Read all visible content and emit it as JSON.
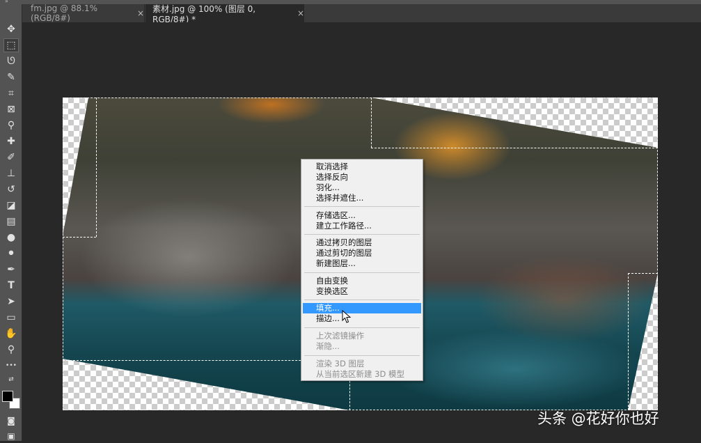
{
  "tabs": [
    {
      "label": "fm.jpg @ 88.1%(RGB/8#)",
      "close": "×",
      "active": false
    },
    {
      "label": "素材.jpg @ 100% (图层 0, RGB/8#) *",
      "close": "×",
      "active": true
    }
  ],
  "panel_collapse_glyph": "»",
  "tools": [
    {
      "name": "move-tool-icon",
      "glyph": "✥"
    },
    {
      "name": "rectangular-marquee-tool-icon",
      "glyph": "⬚"
    },
    {
      "name": "lasso-tool-icon",
      "glyph": "ᘎ"
    },
    {
      "name": "quick-selection-tool-icon",
      "glyph": "✎"
    },
    {
      "name": "crop-tool-icon",
      "glyph": "⌗"
    },
    {
      "name": "frame-tool-icon",
      "glyph": "⊠"
    },
    {
      "name": "eyedropper-tool-icon",
      "glyph": "⚲"
    },
    {
      "name": "healing-brush-tool-icon",
      "glyph": "✚"
    },
    {
      "name": "brush-tool-icon",
      "glyph": "✐"
    },
    {
      "name": "clone-stamp-tool-icon",
      "glyph": "⊥"
    },
    {
      "name": "history-brush-tool-icon",
      "glyph": "↺"
    },
    {
      "name": "eraser-tool-icon",
      "glyph": "◪"
    },
    {
      "name": "gradient-tool-icon",
      "glyph": "▤"
    },
    {
      "name": "blur-tool-icon",
      "glyph": "●"
    },
    {
      "name": "dodge-tool-icon",
      "glyph": "⚫"
    },
    {
      "name": "pen-tool-icon",
      "glyph": "✒"
    },
    {
      "name": "type-tool-icon",
      "glyph": "T"
    },
    {
      "name": "path-selection-tool-icon",
      "glyph": "➤"
    },
    {
      "name": "rectangle-tool-icon",
      "glyph": "▭"
    },
    {
      "name": "hand-tool-icon",
      "glyph": "✋"
    },
    {
      "name": "zoom-tool-icon",
      "glyph": "⚲"
    },
    {
      "name": "more-tools-icon",
      "glyph": "•••"
    }
  ],
  "context_menu": {
    "groups": [
      [
        {
          "label": "取消选择",
          "disabled": false
        },
        {
          "label": "选择反向",
          "disabled": false
        },
        {
          "label": "羽化...",
          "disabled": false
        },
        {
          "label": "选择并遮住...",
          "disabled": false
        }
      ],
      [
        {
          "label": "存储选区...",
          "disabled": false
        },
        {
          "label": "建立工作路径...",
          "disabled": false
        }
      ],
      [
        {
          "label": "通过拷贝的图层",
          "disabled": false
        },
        {
          "label": "通过剪切的图层",
          "disabled": false
        },
        {
          "label": "新建图层...",
          "disabled": false
        }
      ],
      [
        {
          "label": "自由变换",
          "disabled": false
        },
        {
          "label": "变换选区",
          "disabled": false
        }
      ],
      [
        {
          "label": "填充...",
          "disabled": false,
          "highlighted": true
        },
        {
          "label": "描边...",
          "disabled": false
        }
      ],
      [
        {
          "label": "上次滤镜操作",
          "disabled": true
        },
        {
          "label": "渐隐...",
          "disabled": true
        }
      ],
      [
        {
          "label": "渲染 3D 图层",
          "disabled": true
        },
        {
          "label": "从当前选区新建 3D 模型",
          "disabled": true
        }
      ]
    ]
  },
  "colors": {
    "foreground": "#000000",
    "background": "#ffffff",
    "highlight": "#3399ff"
  },
  "watermark": "头条 @花好你也好"
}
